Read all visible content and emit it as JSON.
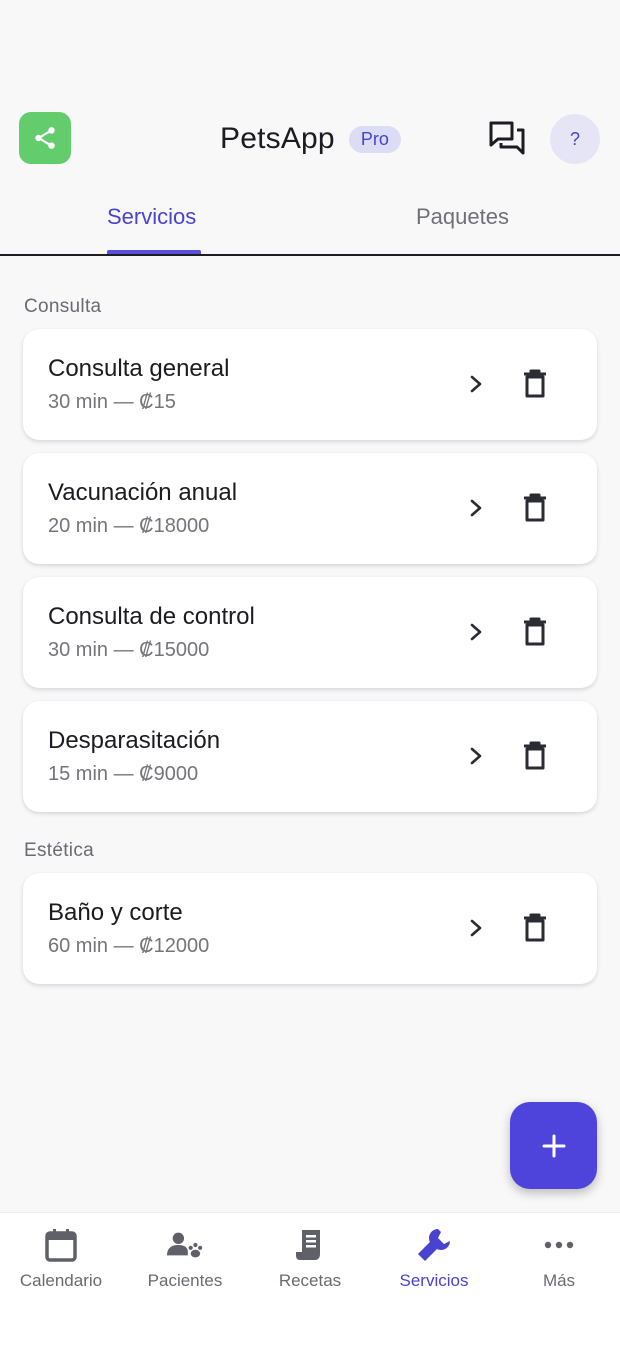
{
  "header": {
    "app_title": "PetsApp",
    "badge": "Pro",
    "help_label": "?",
    "icons": {
      "share": "share-icon",
      "chat": "chat-icon",
      "help": "help-icon"
    }
  },
  "tabs": [
    {
      "label": "Servicios",
      "active": true
    },
    {
      "label": "Paquetes",
      "active": false
    }
  ],
  "sections": [
    {
      "title": "Consulta",
      "items": [
        {
          "name": "Consulta general",
          "meta": "30 min — ₡15"
        },
        {
          "name": "Vacunación anual",
          "meta": "20 min — ₡18000"
        },
        {
          "name": "Consulta de control",
          "meta": "30 min — ₡15000"
        },
        {
          "name": "Desparasitación",
          "meta": "15 min — ₡9000"
        }
      ]
    },
    {
      "title": "Estética",
      "items": [
        {
          "name": "Baño y corte",
          "meta": "60 min — ₡12000"
        }
      ]
    }
  ],
  "fab": {
    "icon": "plus-icon"
  },
  "bottom_nav": [
    {
      "label": "Calendario",
      "icon": "calendar-icon",
      "active": false
    },
    {
      "label": "Pacientes",
      "icon": "patients-icon",
      "active": false
    },
    {
      "label": "Recetas",
      "icon": "receipt-icon",
      "active": false
    },
    {
      "label": "Servicios",
      "icon": "wrench-icon",
      "active": true
    },
    {
      "label": "Más",
      "icon": "more-icon",
      "active": false
    }
  ],
  "colors": {
    "accent": "#4e44dc",
    "share_green": "#63cc6c",
    "badge_bg": "#dddcf6",
    "background": "#f8f8f9"
  }
}
